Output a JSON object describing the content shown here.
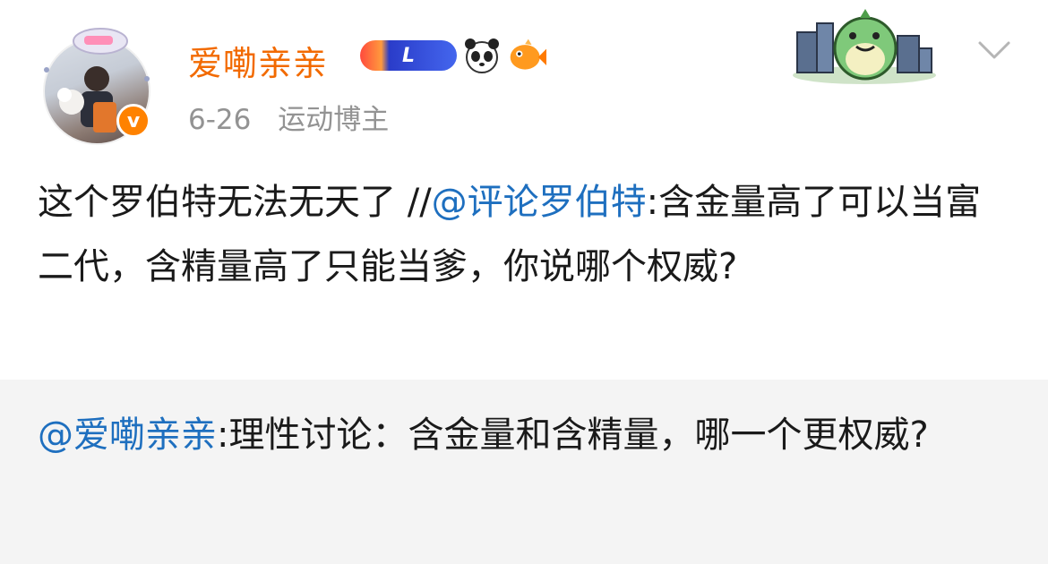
{
  "header": {
    "username": "爱嘞亲亲",
    "date": "6-26",
    "category": "运动博主",
    "level_badge_label": "L",
    "verified_mark": "v"
  },
  "post": {
    "text_main": "这个罗伯特无法无天了 //",
    "mention": "@评论罗伯特",
    "text_after_mention": ":含金量高了可以当富二代，含精量高了只能当爹，你说哪个权威?"
  },
  "repost": {
    "mention": "@爱嘞亲亲",
    "text": ":理性讨论：含金量和含精量，哪一个更权威?"
  },
  "icons": [
    "avatar",
    "verified-badge-icon",
    "dragon-badge-icon",
    "panda-icon",
    "fish-icon",
    "dinosaur-sticker-icon",
    "chevron-down-icon"
  ],
  "colors": {
    "username": "#f26a00",
    "mention": "#1e6fbf",
    "meta": "#939393",
    "repost_bg": "#f4f4f4"
  }
}
